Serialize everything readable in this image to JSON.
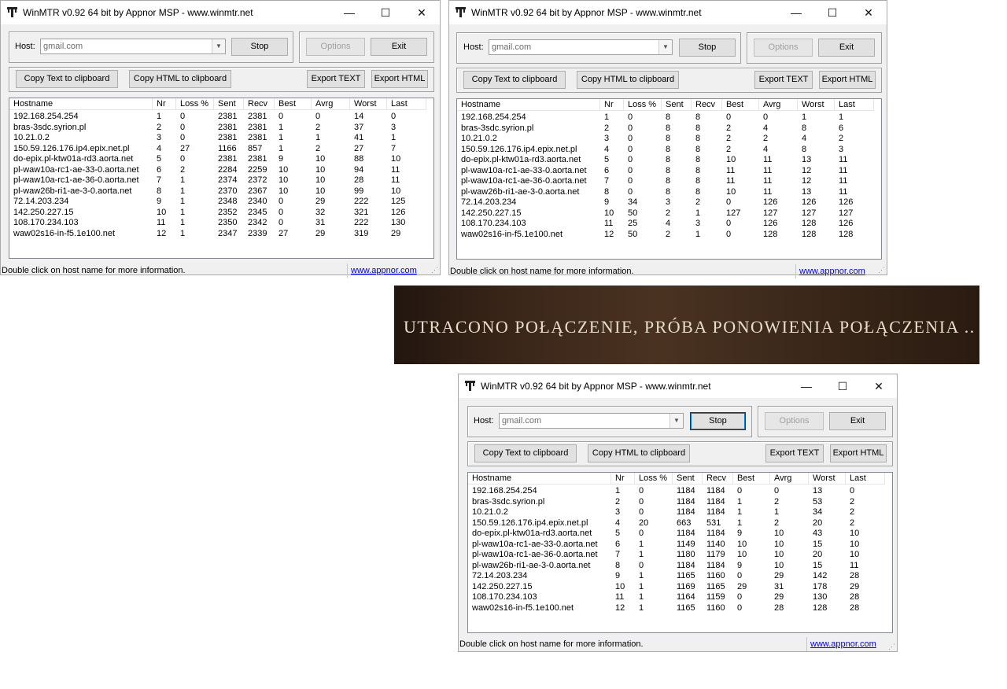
{
  "title": "WinMTR v0.92 64 bit by Appnor MSP - www.winmtr.net",
  "host_label": "Host:",
  "host_value": "gmail.com",
  "buttons": {
    "stop": "Stop",
    "options": "Options",
    "exit": "Exit",
    "copy_text": "Copy Text to clipboard",
    "copy_html": "Copy HTML to clipboard",
    "export_text": "Export TEXT",
    "export_html": "Export HTML"
  },
  "columns": [
    "Hostname",
    "Nr",
    "Loss %",
    "Sent",
    "Recv",
    "Best",
    "Avrg",
    "Worst",
    "Last"
  ],
  "status_text": "Double click on host name for more information.",
  "status_link": "www.appnor.com",
  "banner_text": "Utracono połączenie, próba ponowienia połączenia ..",
  "windows": [
    {
      "rows": [
        [
          "192.168.254.254",
          "1",
          "0",
          "2381",
          "2381",
          "0",
          "0",
          "14",
          "0"
        ],
        [
          "bras-3sdc.syrion.pl",
          "2",
          "0",
          "2381",
          "2381",
          "1",
          "2",
          "37",
          "3"
        ],
        [
          "10.21.0.2",
          "3",
          "0",
          "2381",
          "2381",
          "1",
          "1",
          "41",
          "1"
        ],
        [
          "150.59.126.176.ip4.epix.net.pl",
          "4",
          "27",
          "1166",
          "857",
          "1",
          "2",
          "27",
          "7"
        ],
        [
          "do-epix.pl-ktw01a-rd3.aorta.net",
          "5",
          "0",
          "2381",
          "2381",
          "9",
          "10",
          "88",
          "10"
        ],
        [
          "pl-waw10a-rc1-ae-33-0.aorta.net",
          "6",
          "2",
          "2284",
          "2259",
          "10",
          "10",
          "94",
          "11"
        ],
        [
          "pl-waw10a-rc1-ae-36-0.aorta.net",
          "7",
          "1",
          "2374",
          "2372",
          "10",
          "10",
          "28",
          "11"
        ],
        [
          "pl-waw26b-ri1-ae-3-0.aorta.net",
          "8",
          "1",
          "2370",
          "2367",
          "10",
          "10",
          "99",
          "10"
        ],
        [
          "72.14.203.234",
          "9",
          "1",
          "2348",
          "2340",
          "0",
          "29",
          "222",
          "125"
        ],
        [
          "142.250.227.15",
          "10",
          "1",
          "2352",
          "2345",
          "0",
          "32",
          "321",
          "126"
        ],
        [
          "108.170.234.103",
          "11",
          "1",
          "2350",
          "2342",
          "0",
          "31",
          "222",
          "130"
        ],
        [
          "waw02s16-in-f5.1e100.net",
          "12",
          "1",
          "2347",
          "2339",
          "27",
          "29",
          "319",
          "29"
        ]
      ]
    },
    {
      "rows": [
        [
          "192.168.254.254",
          "1",
          "0",
          "8",
          "8",
          "0",
          "0",
          "1",
          "1"
        ],
        [
          "bras-3sdc.syrion.pl",
          "2",
          "0",
          "8",
          "8",
          "2",
          "4",
          "8",
          "6"
        ],
        [
          "10.21.0.2",
          "3",
          "0",
          "8",
          "8",
          "2",
          "2",
          "4",
          "2"
        ],
        [
          "150.59.126.176.ip4.epix.net.pl",
          "4",
          "0",
          "8",
          "8",
          "2",
          "4",
          "8",
          "3"
        ],
        [
          "do-epix.pl-ktw01a-rd3.aorta.net",
          "5",
          "0",
          "8",
          "8",
          "10",
          "11",
          "13",
          "11"
        ],
        [
          "pl-waw10a-rc1-ae-33-0.aorta.net",
          "6",
          "0",
          "8",
          "8",
          "11",
          "11",
          "12",
          "11"
        ],
        [
          "pl-waw10a-rc1-ae-36-0.aorta.net",
          "7",
          "0",
          "8",
          "8",
          "11",
          "11",
          "12",
          "11"
        ],
        [
          "pl-waw26b-ri1-ae-3-0.aorta.net",
          "8",
          "0",
          "8",
          "8",
          "10",
          "11",
          "13",
          "11"
        ],
        [
          "72.14.203.234",
          "9",
          "34",
          "3",
          "2",
          "0",
          "126",
          "126",
          "126"
        ],
        [
          "142.250.227.15",
          "10",
          "50",
          "2",
          "1",
          "127",
          "127",
          "127",
          "127"
        ],
        [
          "108.170.234.103",
          "11",
          "25",
          "4",
          "3",
          "0",
          "126",
          "128",
          "126"
        ],
        [
          "waw02s16-in-f5.1e100.net",
          "12",
          "50",
          "2",
          "1",
          "0",
          "128",
          "128",
          "128"
        ]
      ]
    },
    {
      "rows": [
        [
          "192.168.254.254",
          "1",
          "0",
          "1184",
          "1184",
          "0",
          "0",
          "13",
          "0"
        ],
        [
          "bras-3sdc.syrion.pl",
          "2",
          "0",
          "1184",
          "1184",
          "1",
          "2",
          "53",
          "2"
        ],
        [
          "10.21.0.2",
          "3",
          "0",
          "1184",
          "1184",
          "1",
          "1",
          "34",
          "2"
        ],
        [
          "150.59.126.176.ip4.epix.net.pl",
          "4",
          "20",
          "663",
          "531",
          "1",
          "2",
          "20",
          "2"
        ],
        [
          "do-epix.pl-ktw01a-rd3.aorta.net",
          "5",
          "0",
          "1184",
          "1184",
          "9",
          "10",
          "43",
          "10"
        ],
        [
          "pl-waw10a-rc1-ae-33-0.aorta.net",
          "6",
          "1",
          "1149",
          "1140",
          "10",
          "10",
          "15",
          "10"
        ],
        [
          "pl-waw10a-rc1-ae-36-0.aorta.net",
          "7",
          "1",
          "1180",
          "1179",
          "10",
          "10",
          "20",
          "10"
        ],
        [
          "pl-waw26b-ri1-ae-3-0.aorta.net",
          "8",
          "0",
          "1184",
          "1184",
          "9",
          "10",
          "15",
          "11"
        ],
        [
          "72.14.203.234",
          "9",
          "1",
          "1165",
          "1160",
          "0",
          "29",
          "142",
          "28"
        ],
        [
          "142.250.227.15",
          "10",
          "1",
          "1169",
          "1165",
          "29",
          "31",
          "178",
          "29"
        ],
        [
          "108.170.234.103",
          "11",
          "1",
          "1164",
          "1159",
          "0",
          "29",
          "130",
          "28"
        ],
        [
          "waw02s16-in-f5.1e100.net",
          "12",
          "1",
          "1165",
          "1160",
          "0",
          "28",
          "128",
          "28"
        ]
      ]
    }
  ]
}
